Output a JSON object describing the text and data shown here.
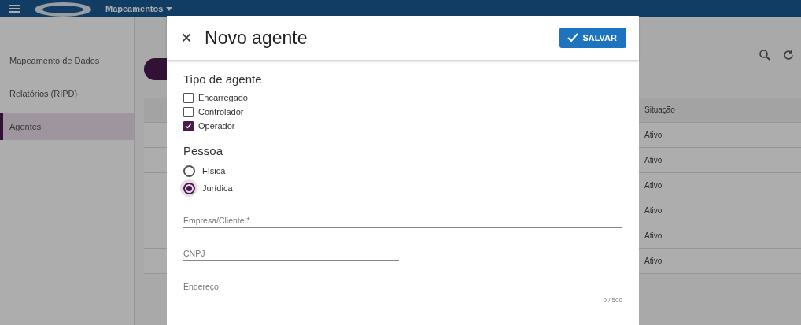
{
  "header": {
    "module": "Mapeamentos"
  },
  "sidebar": {
    "items": [
      {
        "label": "Mapeamento de Dados",
        "selected": false
      },
      {
        "label": "Relatórios (RIPD)",
        "selected": false
      },
      {
        "label": "Agentes",
        "selected": true
      }
    ]
  },
  "table": {
    "columns": [
      "Situação"
    ],
    "rows": [
      {
        "status": "Ativo"
      },
      {
        "status": "Ativo"
      },
      {
        "status": "Ativo"
      },
      {
        "status": "Ativo"
      },
      {
        "status": "Ativo"
      },
      {
        "status": "Ativo"
      }
    ]
  },
  "dialog": {
    "close": "×",
    "title": "Novo agente",
    "save": "SALVAR",
    "agent_type": {
      "title": "Tipo de agente",
      "options": [
        {
          "label": "Encarregado",
          "checked": false
        },
        {
          "label": "Controlador",
          "checked": false
        },
        {
          "label": "Operador",
          "checked": true
        }
      ]
    },
    "person": {
      "title": "Pessoa",
      "options": [
        {
          "label": "Física",
          "selected": false
        },
        {
          "label": "Jurídica",
          "selected": true
        }
      ]
    },
    "fields": [
      {
        "placeholder": "Empresa/Cliente *",
        "kind": "full"
      },
      {
        "placeholder": "CNPJ",
        "kind": "half"
      },
      {
        "placeholder": "Endereço",
        "kind": "full",
        "counter": "0 / 500"
      }
    ]
  }
}
